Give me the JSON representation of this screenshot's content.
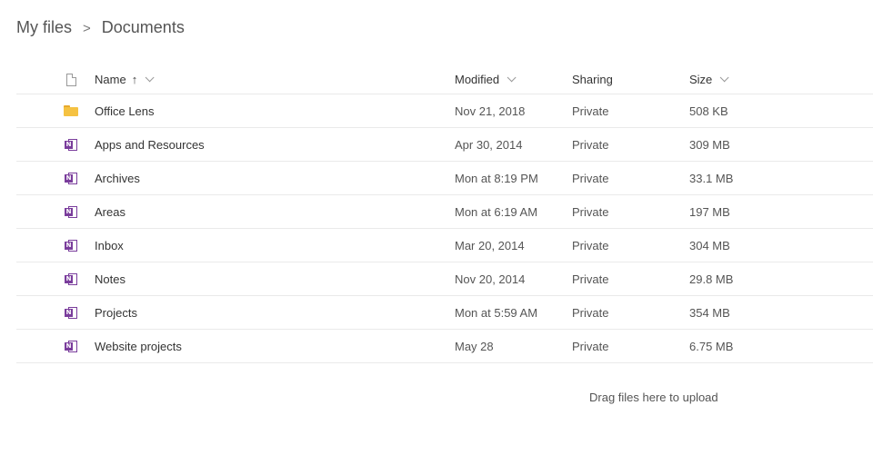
{
  "breadcrumb": {
    "root": "My files",
    "separator": ">",
    "current": "Documents"
  },
  "columns": {
    "name": "Name",
    "sort_arrow": "↑",
    "modified": "Modified",
    "sharing": "Sharing",
    "size": "Size"
  },
  "files": [
    {
      "icon": "folder-icon",
      "name": "Office Lens",
      "modified": "Nov 21, 2018",
      "sharing": "Private",
      "size": "508 KB"
    },
    {
      "icon": "onenote-icon",
      "name": "Apps and Resources",
      "modified": "Apr 30, 2014",
      "sharing": "Private",
      "size": "309 MB"
    },
    {
      "icon": "onenote-icon",
      "name": "Archives",
      "modified": "Mon at 8:19 PM",
      "sharing": "Private",
      "size": "33.1 MB"
    },
    {
      "icon": "onenote-icon",
      "name": "Areas",
      "modified": "Mon at 6:19 AM",
      "sharing": "Private",
      "size": "197 MB"
    },
    {
      "icon": "onenote-icon",
      "name": "Inbox",
      "modified": "Mar 20, 2014",
      "sharing": "Private",
      "size": "304 MB"
    },
    {
      "icon": "onenote-icon",
      "name": "Notes",
      "modified": "Nov 20, 2014",
      "sharing": "Private",
      "size": "29.8 MB"
    },
    {
      "icon": "onenote-icon",
      "name": "Projects",
      "modified": "Mon at 5:59 AM",
      "sharing": "Private",
      "size": "354 MB"
    },
    {
      "icon": "onenote-icon",
      "name": "Website projects",
      "modified": "May 28",
      "sharing": "Private",
      "size": "6.75 MB"
    }
  ],
  "drop_hint": "Drag files here to upload",
  "colors": {
    "folder": "#f5c242",
    "onenote": "#7a3d9c"
  }
}
